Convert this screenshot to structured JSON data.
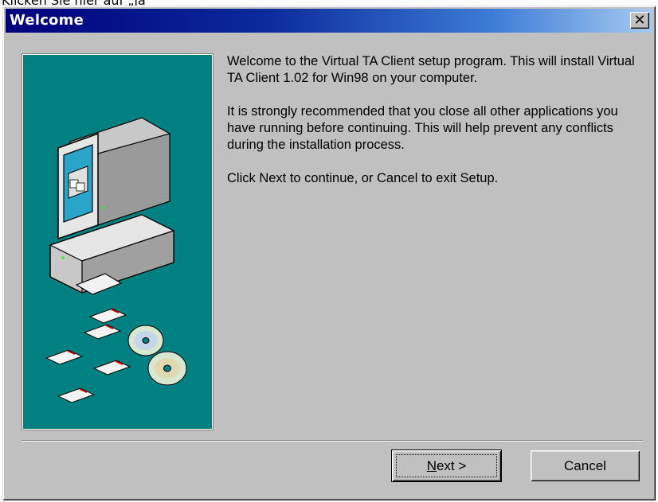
{
  "top_caption": "Klicken Sie hier auf „ja“",
  "window": {
    "title": "Welcome",
    "close_glyph": "✕"
  },
  "illustration": {
    "icon": "computer-with-disks-and-cds",
    "background_color": "#008080"
  },
  "message": {
    "paragraph1": "Welcome to the Virtual TA Client setup program. This will install Virtual TA Client 1.02 for Win98 on your computer.",
    "paragraph2": "It is strongly recommended that you close all other applications you have running before continuing. This will help prevent any conflicts during the installation process.",
    "paragraph3": "Click Next to continue, or Cancel to exit Setup."
  },
  "buttons": {
    "next_mnemonic": "N",
    "next_rest": "ext >",
    "cancel": "Cancel"
  },
  "colors": {
    "titlebar_start": "#00007b",
    "titlebar_end": "#a6caf0",
    "dialog_face": "#c0c0c0"
  }
}
